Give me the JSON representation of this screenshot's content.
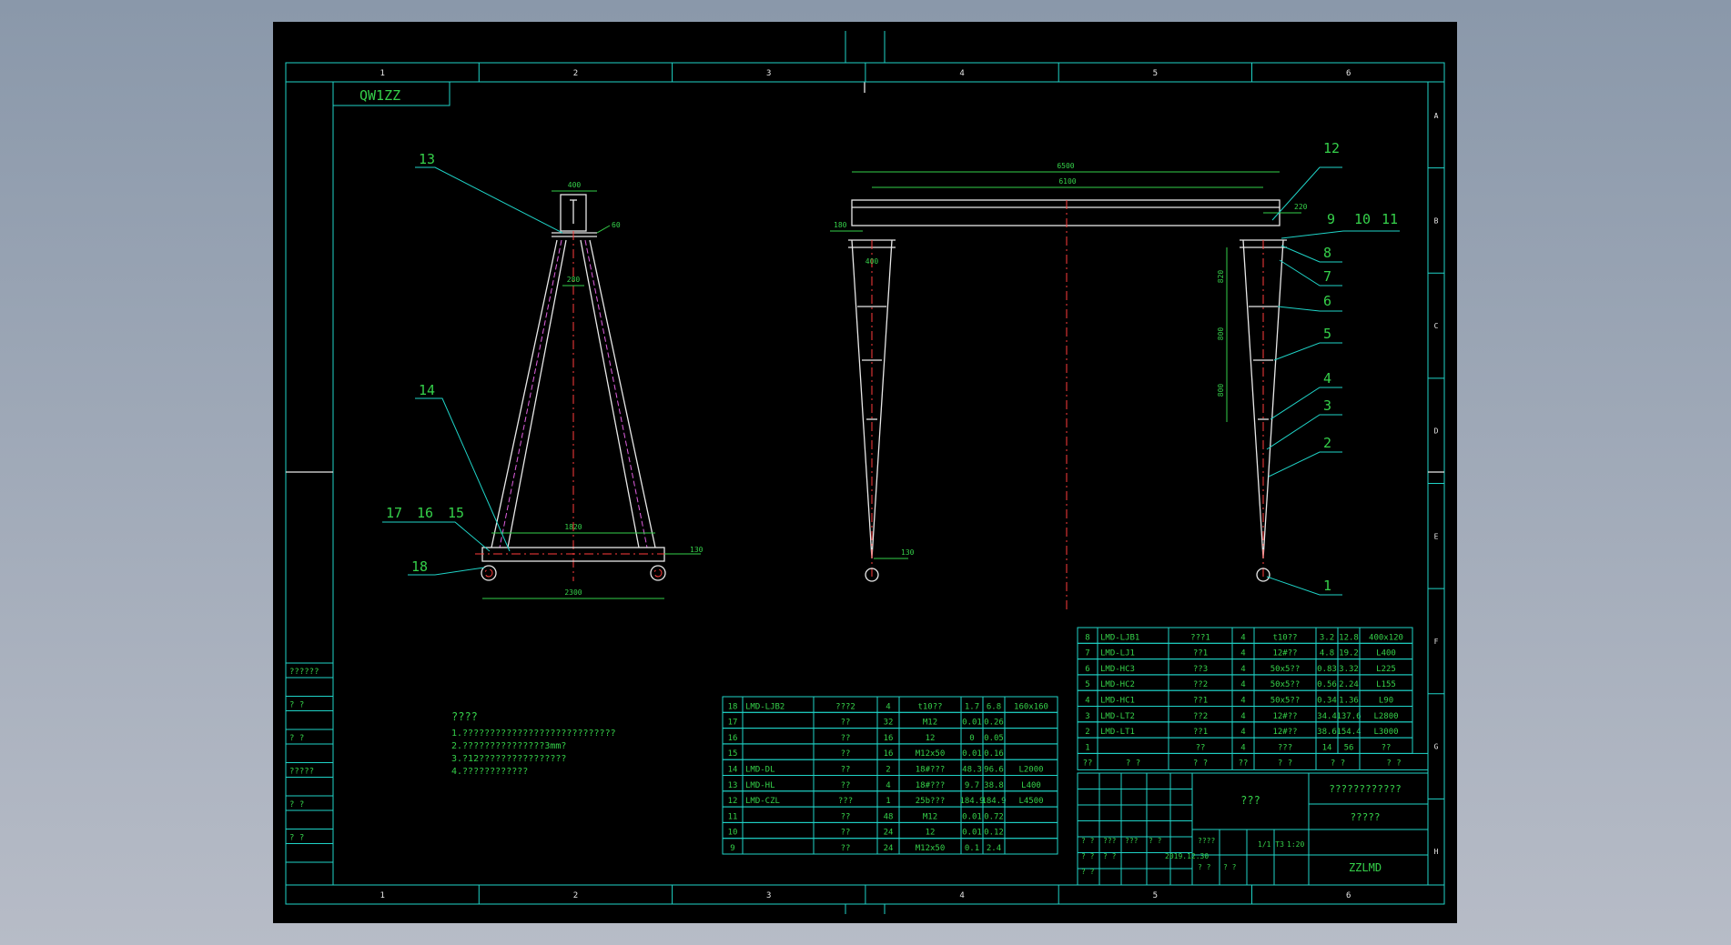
{
  "drawing": {
    "title_block_label": "QW1ZZ",
    "code": "ZZLMD",
    "date": "2019.12.30",
    "scale": "1:20",
    "name_cell": "???",
    "company": "????????????",
    "subtitle": "?????",
    "sheet_no": "1/1 T3",
    "signatures": [
      "? ?",
      "???",
      "???",
      "? ?",
      "? ?",
      "? ?",
      "? ?",
      "????",
      "? ?",
      "? ?"
    ]
  },
  "border": {
    "columns": [
      "1",
      "2",
      "3",
      "4",
      "5",
      "6"
    ],
    "rows": [
      "A",
      "B",
      "C",
      "D",
      "E",
      "F",
      "G",
      "H"
    ],
    "left_strip": [
      "??????",
      "? ?",
      "? ?",
      "?????",
      "? ?",
      "? ?"
    ]
  },
  "notes": {
    "title": "????",
    "lines": [
      "1.????????????????????????????",
      "2.???????????????3mm?",
      "3.?12????????????????",
      "4.????????????"
    ]
  },
  "dims": {
    "side_top_width": "400",
    "side_plate": "60",
    "side_inner": "280",
    "side_base_inner": "1820",
    "side_base_h": "130",
    "side_base_total": "2300",
    "front_overall": "6500",
    "front_inner": "6100",
    "front_left": "180",
    "front_right": "220",
    "front_mid": "400",
    "front_foot": "130",
    "leg_seg1": "820",
    "leg_seg2": "800",
    "leg_seg3": "800"
  },
  "callouts": {
    "side": [
      "13",
      "14",
      "17",
      "16",
      "15",
      "18"
    ],
    "right_group": [
      "12",
      "9",
      "10",
      "11",
      "8",
      "7",
      "6",
      "5",
      "4",
      "3",
      "2",
      "1"
    ]
  },
  "bom_left": [
    [
      "18",
      "LMD-LJB2",
      "???2",
      "4",
      "t10??",
      "1.7",
      "6.8",
      "160x160"
    ],
    [
      "17",
      "",
      "??",
      "32",
      "M12",
      "0.01",
      "0.26",
      ""
    ],
    [
      "16",
      "",
      "??",
      "16",
      "12",
      "0",
      "0.05",
      ""
    ],
    [
      "15",
      "",
      "??",
      "16",
      "M12x50",
      "0.01",
      "0.16",
      ""
    ],
    [
      "14",
      "LMD-DL",
      "??",
      "2",
      "18#???",
      "48.3",
      "96.6",
      "L2000"
    ],
    [
      "13",
      "LMD-HL",
      "??",
      "4",
      "18#???",
      "9.7",
      "38.8",
      "L400"
    ],
    [
      "12",
      "LMD-CZL",
      "???",
      "1",
      "25b???",
      "184.9",
      "184.9",
      "L4500"
    ],
    [
      "11",
      "",
      "??",
      "48",
      "M12",
      "0.01",
      "0.72",
      ""
    ],
    [
      "10",
      "",
      "??",
      "24",
      "12",
      "0.01",
      "0.12",
      ""
    ],
    [
      "9",
      "",
      "??",
      "24",
      "M12x50",
      "0.1",
      "2.4",
      ""
    ]
  ],
  "bom_right": [
    [
      "8",
      "LMD-LJB1",
      "???1",
      "4",
      "t10??",
      "3.2",
      "12.8",
      "400x120"
    ],
    [
      "7",
      "LMD-LJ1",
      "??1",
      "4",
      "12#??",
      "4.8",
      "19.2",
      "L400"
    ],
    [
      "6",
      "LMD-HC3",
      "??3",
      "4",
      "50x5??",
      "0.83",
      "3.32",
      "L225"
    ],
    [
      "5",
      "LMD-HC2",
      "??2",
      "4",
      "50x5??",
      "0.56",
      "2.24",
      "L155"
    ],
    [
      "4",
      "LMD-HC1",
      "??1",
      "4",
      "50x5??",
      "0.34",
      "1.36",
      "L90"
    ],
    [
      "3",
      "LMD-LT2",
      "??2",
      "4",
      "12#??",
      "34.4",
      "137.6",
      "L2800"
    ],
    [
      "2",
      "LMD-LT1",
      "??1",
      "4",
      "12#??",
      "38.6",
      "154.4",
      "L3000"
    ],
    [
      "1",
      "",
      "??",
      "4",
      "???",
      "14",
      "56",
      "??"
    ]
  ],
  "bom_header": [
    "??",
    "? ?",
    "? ?",
    "??",
    "? ?",
    "? ?",
    "? ?"
  ]
}
